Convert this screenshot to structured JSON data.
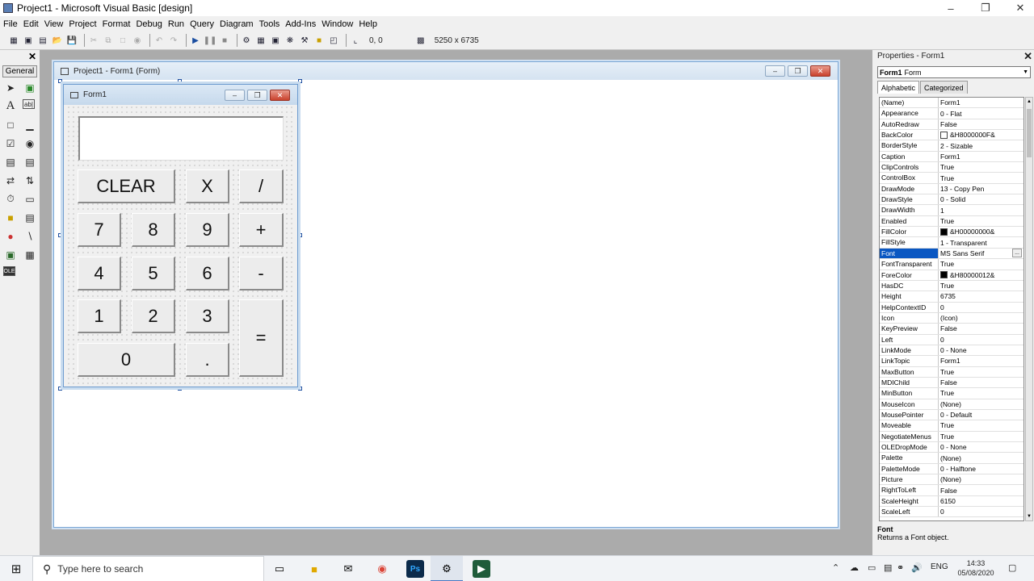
{
  "window": {
    "title": "Project1 - Microsoft Visual Basic [design]"
  },
  "menu": [
    "File",
    "Edit",
    "View",
    "Project",
    "Format",
    "Debug",
    "Run",
    "Query",
    "Diagram",
    "Tools",
    "Add-Ins",
    "Window",
    "Help"
  ],
  "toolbar": {
    "position": "0, 0",
    "size": "5250 x 6735"
  },
  "toolbox": {
    "tab_label": "General"
  },
  "designer": {
    "title": "Project1 - Form1 (Form)"
  },
  "form": {
    "caption": "Form1",
    "display_value": "",
    "buttons": {
      "clear": "CLEAR",
      "multiply": "X",
      "divide": "/",
      "seven": "7",
      "eight": "8",
      "nine": "9",
      "plus": "+",
      "four": "4",
      "five": "5",
      "six": "6",
      "minus": "-",
      "one": "1",
      "two": "2",
      "three": "3",
      "equals": "=",
      "zero": "0",
      "dot": "."
    }
  },
  "properties": {
    "title": "Properties - Form1",
    "object_name": "Form1",
    "object_type": "Form",
    "tabs": [
      "Alphabetic",
      "Categorized"
    ],
    "rows": [
      {
        "name": "(Name)",
        "value": "Form1"
      },
      {
        "name": "Appearance",
        "value": "0 - Flat"
      },
      {
        "name": "AutoRedraw",
        "value": "False"
      },
      {
        "name": "BackColor",
        "value": "&H8000000F&",
        "swatch": "#ffffff"
      },
      {
        "name": "BorderStyle",
        "value": "2 - Sizable"
      },
      {
        "name": "Caption",
        "value": "Form1"
      },
      {
        "name": "ClipControls",
        "value": "True"
      },
      {
        "name": "ControlBox",
        "value": "True"
      },
      {
        "name": "DrawMode",
        "value": "13 - Copy Pen"
      },
      {
        "name": "DrawStyle",
        "value": "0 - Solid"
      },
      {
        "name": "DrawWidth",
        "value": "1"
      },
      {
        "name": "Enabled",
        "value": "True"
      },
      {
        "name": "FillColor",
        "value": "&H00000000&",
        "swatch": "#000000"
      },
      {
        "name": "FillStyle",
        "value": "1 - Transparent"
      },
      {
        "name": "Font",
        "value": "MS Sans Serif",
        "selected": true
      },
      {
        "name": "FontTransparent",
        "value": "True"
      },
      {
        "name": "ForeColor",
        "value": "&H80000012&",
        "swatch": "#000000"
      },
      {
        "name": "HasDC",
        "value": "True"
      },
      {
        "name": "Height",
        "value": "6735"
      },
      {
        "name": "HelpContextID",
        "value": "0"
      },
      {
        "name": "Icon",
        "value": "(Icon)"
      },
      {
        "name": "KeyPreview",
        "value": "False"
      },
      {
        "name": "Left",
        "value": "0"
      },
      {
        "name": "LinkMode",
        "value": "0 - None"
      },
      {
        "name": "LinkTopic",
        "value": "Form1"
      },
      {
        "name": "MaxButton",
        "value": "True"
      },
      {
        "name": "MDIChild",
        "value": "False"
      },
      {
        "name": "MinButton",
        "value": "True"
      },
      {
        "name": "MouseIcon",
        "value": "(None)"
      },
      {
        "name": "MousePointer",
        "value": "0 - Default"
      },
      {
        "name": "Moveable",
        "value": "True"
      },
      {
        "name": "NegotiateMenus",
        "value": "True"
      },
      {
        "name": "OLEDropMode",
        "value": "0 - None"
      },
      {
        "name": "Palette",
        "value": "(None)"
      },
      {
        "name": "PaletteMode",
        "value": "0 - Halftone"
      },
      {
        "name": "Picture",
        "value": "(None)"
      },
      {
        "name": "RightToLeft",
        "value": "False"
      },
      {
        "name": "ScaleHeight",
        "value": "6150"
      },
      {
        "name": "ScaleLeft",
        "value": "0"
      }
    ],
    "description_title": "Font",
    "description_text": "Returns a Font object."
  },
  "taskbar": {
    "search_placeholder": "Type here to search",
    "language": "ENG",
    "time": "14:33",
    "date": "05/08/2020"
  }
}
